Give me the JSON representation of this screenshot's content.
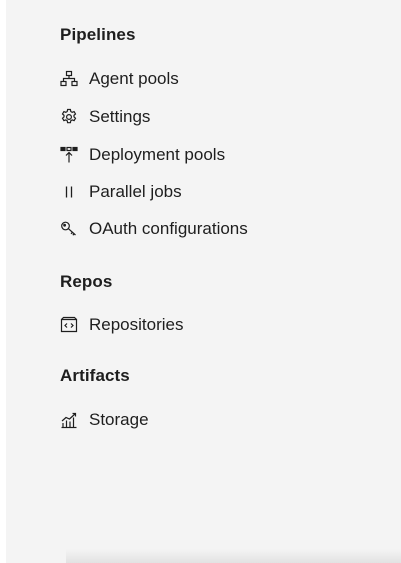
{
  "sections": [
    {
      "title": "Pipelines",
      "items": [
        {
          "label": "Agent pools",
          "icon": "agent-pools-icon"
        },
        {
          "label": "Settings",
          "icon": "gear-icon"
        },
        {
          "label": "Deployment pools",
          "icon": "deployment-pools-icon"
        },
        {
          "label": "Parallel jobs",
          "icon": "parallel-jobs-icon"
        },
        {
          "label": "OAuth configurations",
          "icon": "key-icon"
        }
      ]
    },
    {
      "title": "Repos",
      "items": [
        {
          "label": "Repositories",
          "icon": "repository-icon"
        }
      ]
    },
    {
      "title": "Artifacts",
      "items": [
        {
          "label": "Storage",
          "icon": "storage-chart-icon"
        }
      ]
    }
  ],
  "colors": {
    "background": "#f4f4f4",
    "text": "#1e1e1e"
  }
}
